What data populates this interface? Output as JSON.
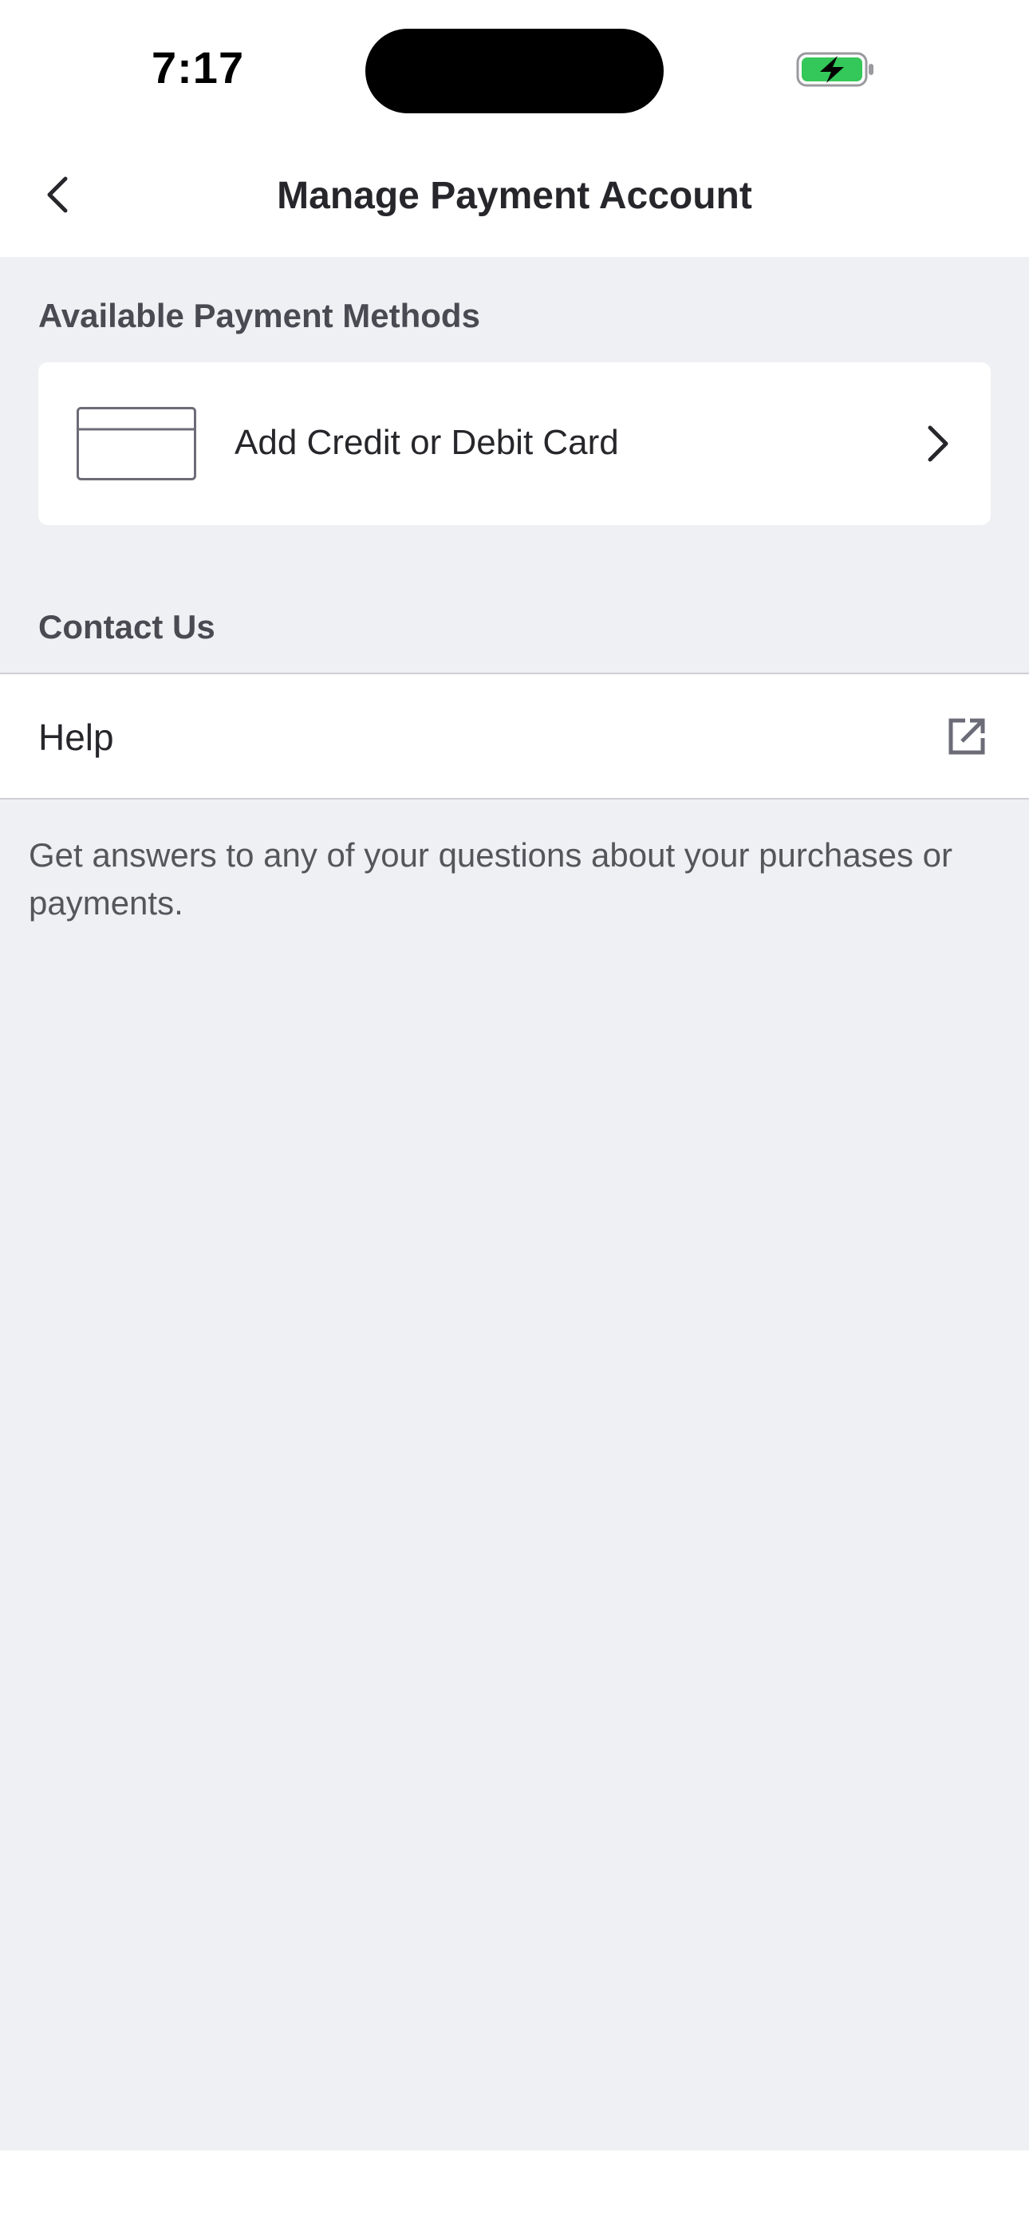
{
  "status_bar": {
    "time": "7:17",
    "battery_icon": "battery-charging-icon",
    "battery_color": "#34c759"
  },
  "nav": {
    "back_icon": "chevron-left-icon",
    "title": "Manage Payment Account"
  },
  "payment_methods": {
    "header": "Available Payment Methods",
    "add_card": {
      "icon": "credit-card-icon",
      "label": "Add Credit or Debit Card",
      "chevron_icon": "chevron-right-icon"
    }
  },
  "contact": {
    "header": "Contact Us",
    "help": {
      "label": "Help",
      "icon": "external-link-icon"
    },
    "description": "Get answers to any of your questions about your purchases or payments."
  },
  "colors": {
    "background": "#eff0f4",
    "text_primary": "#26262b",
    "text_secondary": "#4a4a52"
  }
}
